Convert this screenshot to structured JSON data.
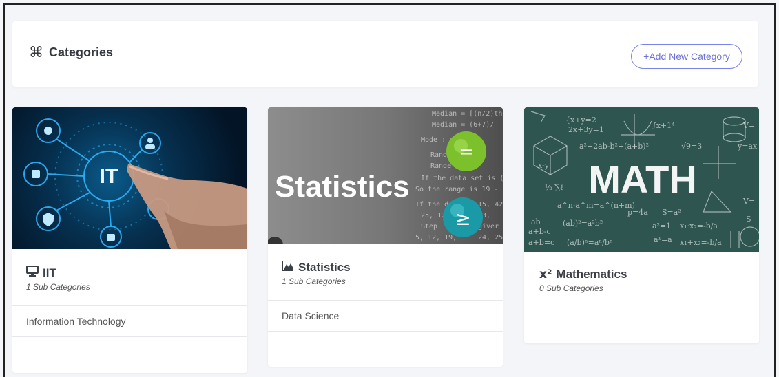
{
  "header": {
    "title": "Categories",
    "add_button_label": "+Add New Category"
  },
  "categories": [
    {
      "name": "IIT",
      "sub_count": "1 Sub Categories",
      "image_text": "IT",
      "icon": "monitor-icon",
      "items": [
        "Information Technology"
      ]
    },
    {
      "name": "Statistics",
      "sub_count": "1 Sub Categories",
      "image_text": "Statistics",
      "icon": "area-chart-icon",
      "items": [
        "Data Science"
      ]
    },
    {
      "name": "Mathematics",
      "sub_count": "0 Sub Categories",
      "image_text": "MATH",
      "icon": "superscript-icon",
      "items": []
    }
  ],
  "colors": {
    "accent": "#6c72d9",
    "page_bg": "#f3f5f9",
    "card_bg": "#ffffff"
  }
}
